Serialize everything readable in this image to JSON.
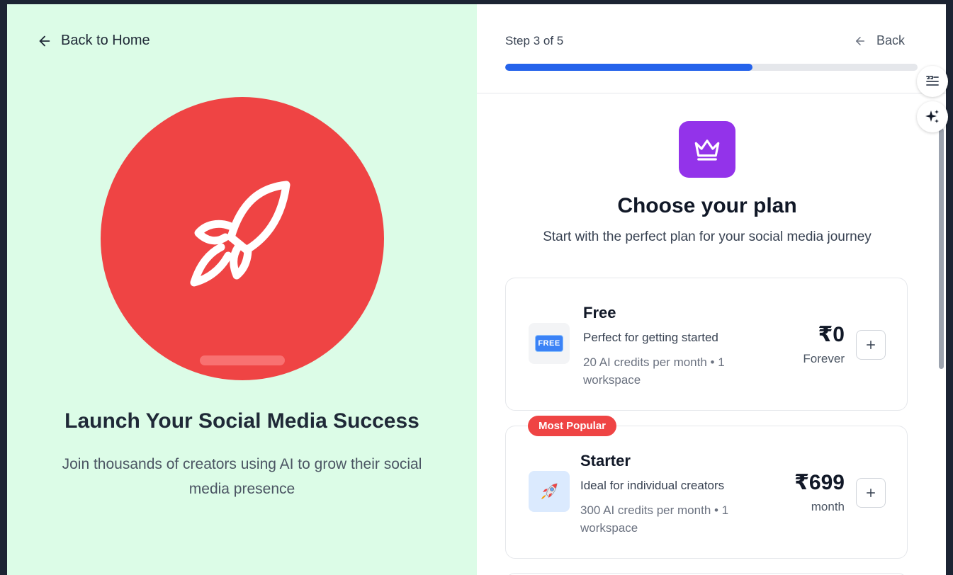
{
  "left_panel": {
    "back_home_label": "Back to Home",
    "title": "Launch Your Social Media Success",
    "subtitle": "Join thousands of creators using AI to grow their social media presence",
    "hero_icon": "rocket-icon",
    "hero_color": "#ef4444",
    "background": "#dcfce7"
  },
  "header": {
    "step_label": "Step 3 of 5",
    "back_label": "Back",
    "progress": 0.6,
    "progress_color": "#2563eb"
  },
  "main": {
    "icon": "crown-icon",
    "icon_color": "#9333ea",
    "title": "Choose your plan",
    "subtitle": "Start with the perfect plan for your social media journey"
  },
  "plans": [
    {
      "name": "Free",
      "description": "Perfect for getting started",
      "details": "20 AI credits per month • 1 workspace",
      "price": "₹0",
      "period": "Forever",
      "icon": "free-badge-icon",
      "icon_text": "FREE"
    },
    {
      "badge": "Most Popular",
      "name": "Starter",
      "description": "Ideal for individual creators",
      "details": "300 AI credits per month • 1 workspace",
      "price": "₹699",
      "period": "month",
      "icon": "rocket-emoji-icon"
    }
  ],
  "side_tools": [
    "quote-list-icon",
    "sparkles-icon"
  ]
}
